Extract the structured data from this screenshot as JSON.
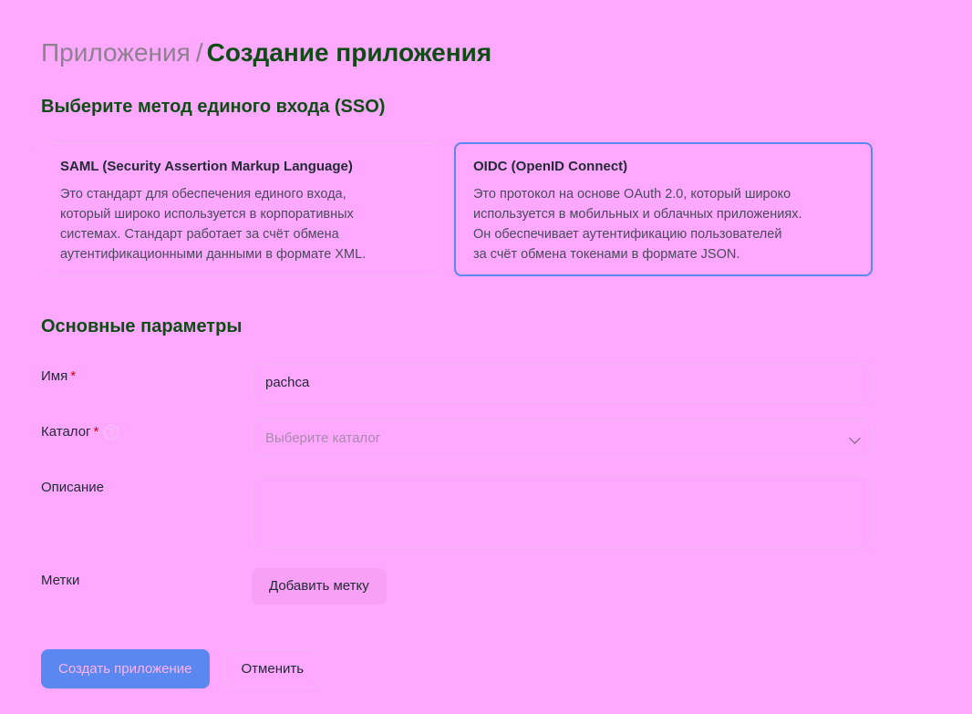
{
  "breadcrumb": {
    "parent": "Приложения",
    "separator": "/",
    "current": "Создание приложения"
  },
  "sso": {
    "section_title": "Выберите метод единого входа (SSO)",
    "options": [
      {
        "title": "SAML (Security Assertion Markup Language)",
        "description": "Это стандарт для обеспечения единого входа,\nкоторый широко используется в корпоративных\nсистемах. Стандарт работает за счёт обмена\nаутентификационными данными в формате XML.",
        "selected": false
      },
      {
        "title": "OIDC (OpenID Connect)",
        "description": "Это протокол на основе OAuth 2.0, который широко\nиспользуется в мобильных и облачных приложениях.\nОн обеспечивает аутентификацию пользователей\nза счёт обмена токенами в формате JSON.",
        "selected": true
      }
    ]
  },
  "params": {
    "section_title": "Основные параметры",
    "name": {
      "label": "Имя",
      "required_mark": "*",
      "value": "pachca"
    },
    "catalog": {
      "label": "Каталог",
      "required_mark": "*",
      "help_icon": "question-circle-icon",
      "help_glyph": "?",
      "placeholder": "Выберите каталог",
      "dropdown_icon": "chevron-down-icon"
    },
    "description": {
      "label": "Описание",
      "value": ""
    },
    "tags": {
      "label": "Метки",
      "add_button": "Добавить метку"
    }
  },
  "actions": {
    "create": "Создать приложение",
    "cancel": "Отменить"
  },
  "colors": {
    "background": "#ffa8ff",
    "accent": "#5a87f0",
    "heading": "#0d4d14",
    "required": "#d60000"
  }
}
